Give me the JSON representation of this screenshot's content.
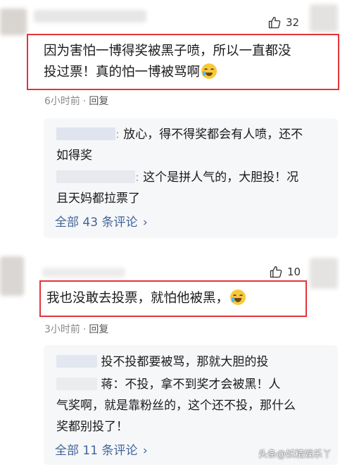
{
  "comments": [
    {
      "likes": "32",
      "text_line1": "因为害怕一博得奖被黑子喷，所以一直都没",
      "text_line2": "投过票！真的怕一博被骂啊",
      "time": "6小时前",
      "reply_label": "回复",
      "replies": [
        {
          "line1": "放心，得不得奖都会有人喷，还不",
          "line2": "如得奖"
        },
        {
          "line1": "这个是拼人气的，大胆投！况",
          "line2": "且天妈都拉票了"
        }
      ],
      "more": "全部 43 条评论"
    },
    {
      "likes": "10",
      "text_line1": "我也没敢去投票，就怕他被黑，",
      "time": "3小时前",
      "reply_label": "回复",
      "replies": [
        {
          "line1": "投不投都要被骂，那就大胆的投"
        },
        {
          "line1": "蒋：不投，拿不到奖才会被黑！人",
          "line2": "气奖啊，就是靠粉丝的，这个还不投，那什么",
          "line3": "奖都别投了！"
        }
      ],
      "more": "全部 11 条评论"
    }
  ],
  "watermark": "头条@妖精娱乐丫",
  "colors": {
    "highlight_border": "#e3343a",
    "link": "#406599",
    "meta": "#8a8a8a",
    "reply_bg": "#f6f7f9"
  },
  "icons": [
    "thumbs-up-icon",
    "chevron-right-icon",
    "crying-laughing-emoji",
    "loudly-crying-emoji"
  ]
}
